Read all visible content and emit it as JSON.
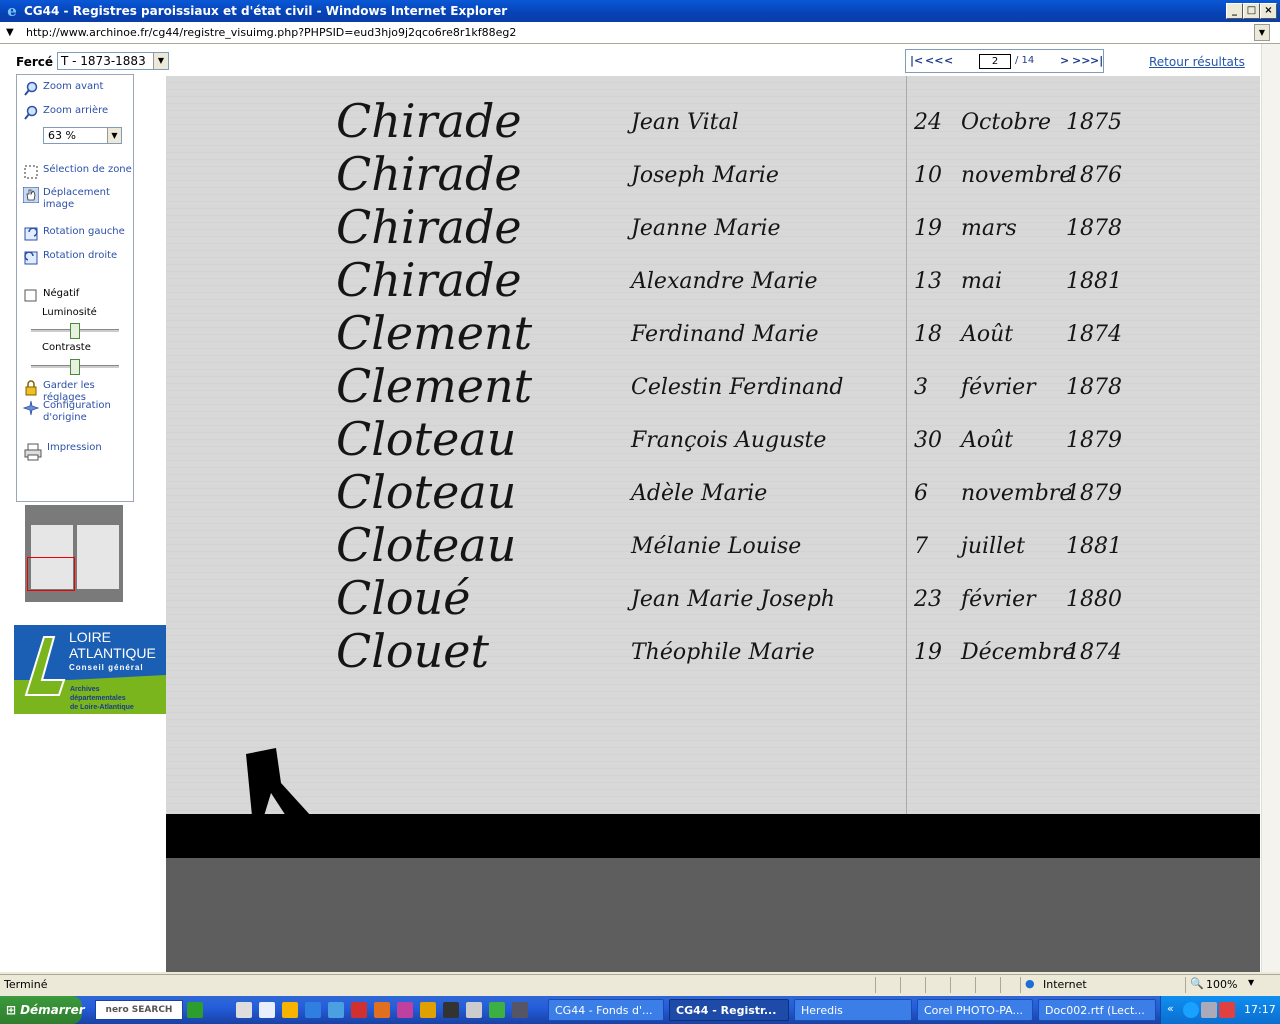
{
  "window": {
    "title": "CG44 - Registres paroissiaux et d'état civil - Windows Internet Explorer",
    "url": "http://www.archinoe.fr/cg44/registre_visuimg.php?PHPSID=eud3hjo9j2qco6re8r1kf88eg2"
  },
  "header": {
    "force_label": "Fercé",
    "register_value": "T - 1873-1883",
    "retour_label": "Retour résultats"
  },
  "pager": {
    "first": "|<",
    "prev_many": "<<",
    "prev": "<",
    "current_page": "2",
    "total": "/ 14",
    "next": ">",
    "next_many": ">>",
    "last": ">|"
  },
  "toolbar": {
    "zoom_in": "Zoom avant",
    "zoom_out": "Zoom arrière",
    "zoom_level": "63 %",
    "select_zone": "Sélection de zone",
    "move_image": "Déplacement image",
    "rotate_left": "Rotation gauche",
    "rotate_right": "Rotation droite",
    "negative": "Négatif",
    "brightness": "Luminosité",
    "brightness_level": 0.5,
    "contrast": "Contraste",
    "contrast_level": 0.5,
    "keep_settings": "Garder les réglages",
    "original_config_1": "Configuration",
    "original_config_2": "d'origine",
    "print": "Impression"
  },
  "logo": {
    "line1": "LOIRE",
    "line2": "ATLANTIQUE",
    "line3": "Conseil général",
    "line4": "Archives",
    "line5": "départementales",
    "line6": "de Loire-Atlantique",
    "blue": "#1a5fb4",
    "green": "#7ab51d"
  },
  "document": {
    "entries": [
      {
        "surname": "Chirade",
        "given": "Jean Vital",
        "day": "24",
        "month": "Octobre",
        "year": "1875"
      },
      {
        "surname": "Chirade",
        "given": "Joseph Marie",
        "day": "10",
        "month": "novembre",
        "year": "1876"
      },
      {
        "surname": "Chirade",
        "given": "Jeanne Marie",
        "day": "19",
        "month": "mars",
        "year": "1878"
      },
      {
        "surname": "Chirade",
        "given": "Alexandre Marie",
        "day": "13",
        "month": "mai",
        "year": "1881"
      },
      {
        "surname": "Clement",
        "given": "Ferdinand Marie",
        "day": "18",
        "month": "Août",
        "year": "1874"
      },
      {
        "surname": "Clement",
        "given": "Celestin Ferdinand",
        "day": "3",
        "month": "février",
        "year": "1878"
      },
      {
        "surname": "Cloteau",
        "given": "François Auguste",
        "day": "30",
        "month": "Août",
        "year": "1879"
      },
      {
        "surname": "Cloteau",
        "given": "Adèle Marie",
        "day": "6",
        "month": "novembre",
        "year": "1879"
      },
      {
        "surname": "Cloteau",
        "given": "Mélanie Louise",
        "day": "7",
        "month": "juillet",
        "year": "1881"
      },
      {
        "surname": "Cloué",
        "given": "Jean Marie Joseph",
        "day": "23",
        "month": "février",
        "year": "1880"
      },
      {
        "surname": "Clouet",
        "given": "Théophile Marie",
        "day": "19",
        "month": "Décembre",
        "year": "1874"
      }
    ]
  },
  "status": {
    "text": "Terminé",
    "zone": "Internet",
    "zoom": "100%"
  },
  "taskbar": {
    "start": "Démarrer",
    "search": "nero SEARCH",
    "buttons": [
      {
        "label": "CG44 - Fonds d'..."
      },
      {
        "label": "CG44 - Registr..."
      },
      {
        "label": "Heredis"
      },
      {
        "label": "Corel PHOTO-PA..."
      },
      {
        "label": "Doc002.rtf (Lect..."
      }
    ],
    "clock": "17:17"
  }
}
